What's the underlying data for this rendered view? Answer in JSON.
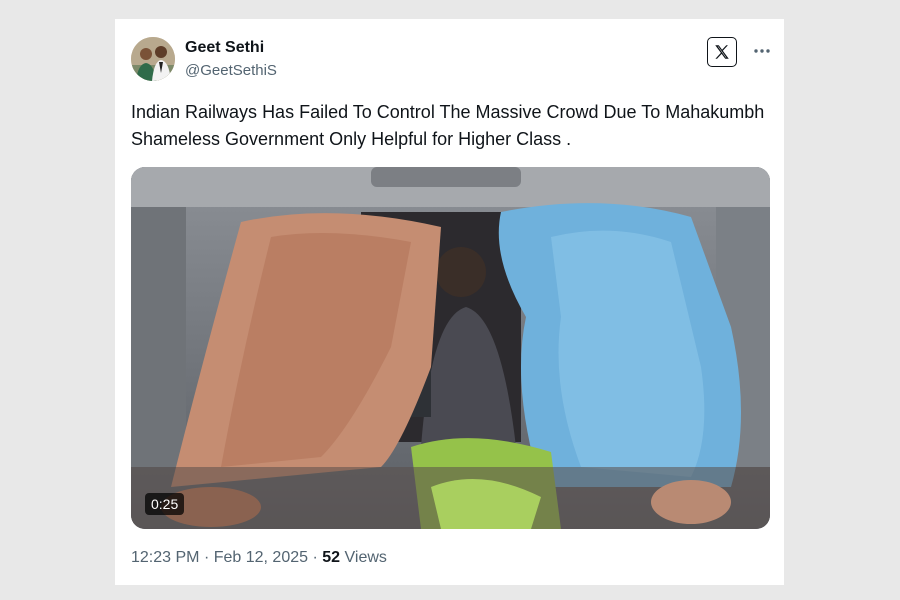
{
  "tweet": {
    "author_name": "Geet Sethi",
    "author_handle": "@GeetSethiS",
    "text": "Indian Railways Has Failed To Control The Massive Crowd Due To Mahakumbh Shameless Government Only Helpful for Higher Class .",
    "video_duration": "0:25",
    "time": "12:23 PM",
    "date": "Feb 12, 2025",
    "separator": "·",
    "views_count": "52",
    "views_label": "Views"
  },
  "icons": {
    "brand": "x-logo-icon",
    "menu": "more-options-icon",
    "avatar": "profile-photo"
  },
  "colors": {
    "text_primary": "#0f1419",
    "text_secondary": "#536471",
    "page_background": "#e8e8e8",
    "card_background": "#ffffff"
  }
}
